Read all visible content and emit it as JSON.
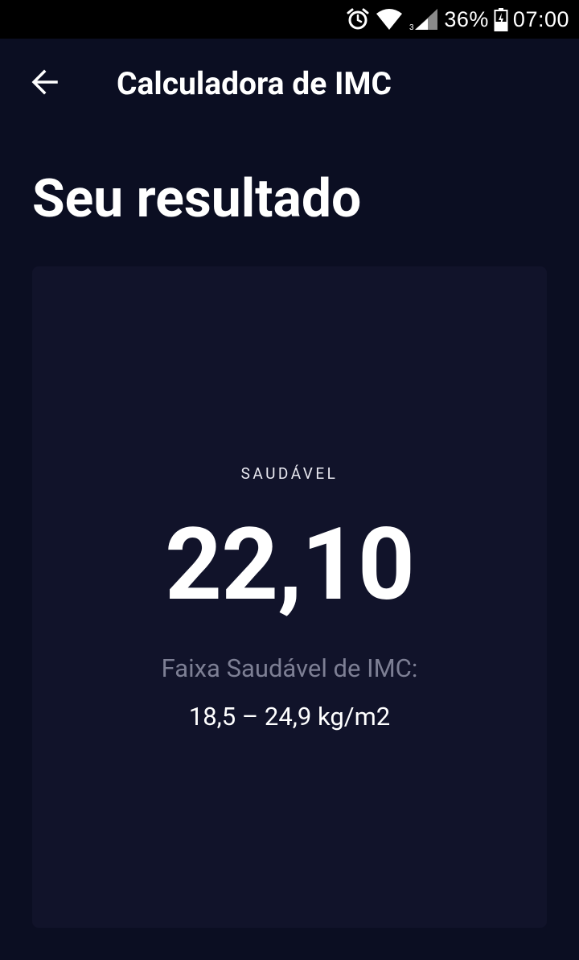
{
  "status_bar": {
    "battery_percent": "36%",
    "time": "07:00",
    "icons": [
      "alarm-icon",
      "wifi-icon",
      "cell-signal-icon",
      "battery-icon"
    ]
  },
  "toolbar": {
    "title": "Calculadora de IMC",
    "back_icon": "arrow-left-icon"
  },
  "page": {
    "heading": "Seu resultado"
  },
  "result": {
    "category": "SAUDÁVEL",
    "bmi": "22,10",
    "range_label": "Faixa Saudável de IMC:",
    "range_value": "18,5 – 24,9 kg/m2"
  },
  "colors": {
    "background": "#0b0e22",
    "card": "#11132a",
    "status_bar": "#000000",
    "text_primary": "#ffffff",
    "text_secondary": "#7d7f94"
  }
}
